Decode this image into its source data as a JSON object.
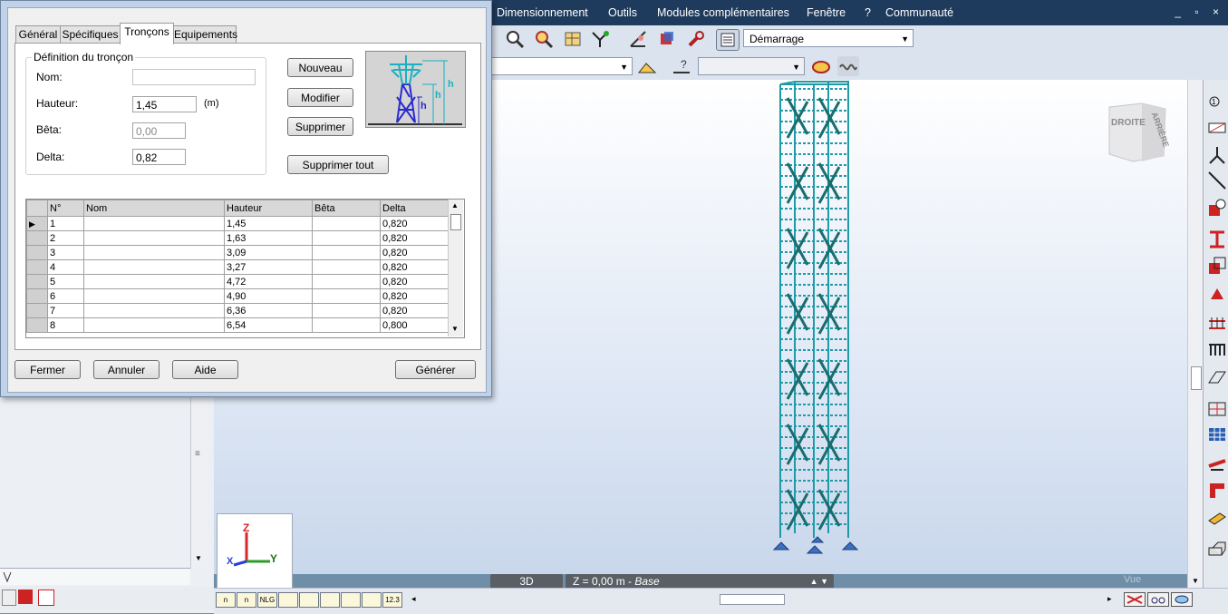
{
  "menu": {
    "items": [
      "Dimensionnement",
      "Outils",
      "Modules complémentaires",
      "Fenêtre",
      "?",
      "Communauté"
    ],
    "window_controls": "_ ▫ ×"
  },
  "toolbar": {
    "layout_combo": "Démarrage"
  },
  "dialog": {
    "tabs": [
      "Général",
      "Spécifiques",
      "Tronçons",
      "Equipements"
    ],
    "active_tab": "Tronçons",
    "group_title": "Définition du tronçon",
    "fields": {
      "nom_label": "Nom:",
      "nom_value": "",
      "hauteur_label": "Hauteur:",
      "hauteur_value": "1,45",
      "hauteur_unit": "(m)",
      "beta_label": "Bêta:",
      "beta_value": "0,00",
      "delta_label": "Delta:",
      "delta_value": "0,82"
    },
    "buttons": {
      "nouveau": "Nouveau",
      "modifier": "Modifier",
      "supprimer": "Supprimer",
      "supprimer_tout": "Supprimer tout",
      "fermer": "Fermer",
      "annuler": "Annuler",
      "aide": "Aide",
      "generer": "Générer"
    },
    "preview_labels": [
      "h",
      "h",
      "h"
    ],
    "grid": {
      "columns": [
        "N°",
        "Nom",
        "Hauteur",
        "Bêta",
        "Delta"
      ],
      "rows": [
        [
          "1",
          "",
          "1,45",
          "",
          "0,820"
        ],
        [
          "2",
          "",
          "1,63",
          "",
          "0,820"
        ],
        [
          "3",
          "",
          "3,09",
          "",
          "0,820"
        ],
        [
          "4",
          "",
          "3,27",
          "",
          "0,820"
        ],
        [
          "5",
          "",
          "4,72",
          "",
          "0,820"
        ],
        [
          "6",
          "",
          "4,90",
          "",
          "0,820"
        ],
        [
          "7",
          "",
          "6,36",
          "",
          "0,820"
        ],
        [
          "8",
          "",
          "6,54",
          "",
          "0,800"
        ]
      ]
    }
  },
  "viewport": {
    "view_cube": [
      "DROITE",
      "ARRIÈRE"
    ],
    "view_mode": "3D",
    "level_label": "Z = 0,00 m - ",
    "level_name": "Base",
    "axes": [
      "Z",
      "X",
      "Y"
    ],
    "watermark": "Vue"
  },
  "bottom_icons": [
    "n",
    "n",
    "NLG",
    "",
    "",
    "",
    "",
    "",
    "12.3"
  ],
  "colors": {
    "structure": "#1f9aa6",
    "menubar": "#1e3a5c",
    "dialog_frame": "#c0d2e8"
  }
}
